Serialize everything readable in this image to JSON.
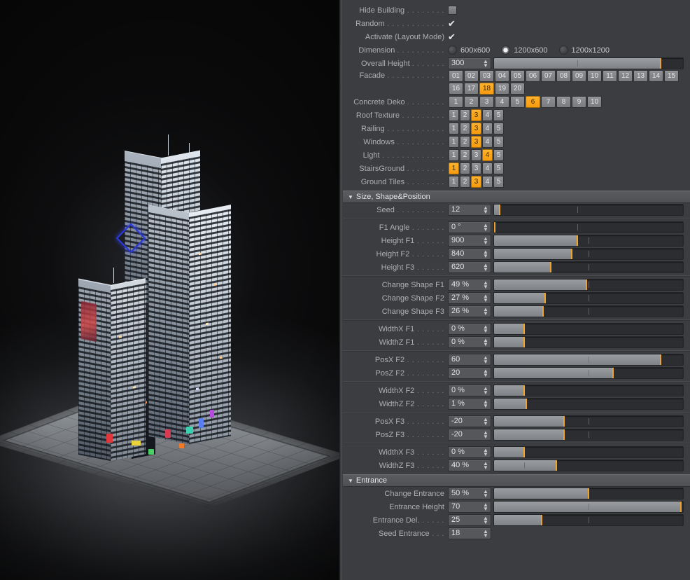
{
  "viewport": {
    "name": "3d-perspective-viewport",
    "scene_description": "Rendered night skyscraper complex on a paved plaza base"
  },
  "panel": {
    "toggles": [
      {
        "label": "Hide Building",
        "dots": ". . . . . . . .",
        "type": "checkbox",
        "checked": false
      },
      {
        "label": "Random",
        "dots": ". . . . . . . . . . . .",
        "type": "checkbox",
        "checked": true
      },
      {
        "label": "Activate (Layout Mode)",
        "dots": "",
        "type": "checkbox",
        "checked": true
      }
    ],
    "dimension": {
      "label": "Dimension",
      "dots": ". . . . . . . . . .",
      "options": [
        "600x600",
        "1200x600",
        "1200x1200"
      ],
      "selected_index": 1
    },
    "overall_height": {
      "label": "Overall Height",
      "dots": ". . . . . . .",
      "value": "300",
      "fill_pct": 88,
      "mark_pct": 88,
      "tick_pct": 44
    },
    "facade": {
      "label": "Facade",
      "dots": ". . . . . . . . . . . .",
      "options": [
        "01",
        "02",
        "03",
        "04",
        "05",
        "06",
        "07",
        "08",
        "09",
        "10",
        "11",
        "12",
        "13",
        "14",
        "15",
        "16",
        "17",
        "18",
        "19",
        "20"
      ],
      "selected": "18"
    },
    "concrete_deko": {
      "label": "Concrete Deko",
      "dots": ". . . . . . . .",
      "options": [
        "1",
        "2",
        "3",
        "4",
        "5",
        "6",
        "7",
        "8",
        "9",
        "10"
      ],
      "selected": "6"
    },
    "small_groups": [
      {
        "label": "Roof Texture",
        "dots": ". . . . . . . . .",
        "options": [
          "1",
          "2",
          "3",
          "4",
          "5"
        ],
        "selected": "3"
      },
      {
        "label": "Railing",
        "dots": ". . . . . . . . . . . .",
        "options": [
          "1",
          "2",
          "3",
          "4",
          "5"
        ],
        "selected": "3"
      },
      {
        "label": "Windows",
        "dots": ". . . . . . . . . .",
        "options": [
          "1",
          "2",
          "3",
          "4",
          "5"
        ],
        "selected": "3"
      },
      {
        "label": "Light",
        "dots": ". . . . . . . . . . . . .",
        "options": [
          "1",
          "2",
          "3",
          "4",
          "5"
        ],
        "selected": "4"
      },
      {
        "label": "StairsGround",
        "dots": ". . . . . . . .",
        "options": [
          "1",
          "2",
          "3",
          "4",
          "5"
        ],
        "selected": "1"
      },
      {
        "label": "Ground Tiles",
        "dots": ". . . . . . . .",
        "options": [
          "1",
          "2",
          "3",
          "4",
          "5"
        ],
        "selected": "3"
      }
    ],
    "section_size": {
      "title": "Size, Shape&Position",
      "groups": [
        {
          "rows": [
            {
              "label": "Seed",
              "dots": ". . . . . . . . . .",
              "value": "12",
              "fill_pct": 3,
              "mark_pct": 3,
              "tick_pct": 44
            }
          ]
        },
        {
          "rows": [
            {
              "label": "F1 Angle",
              "dots": ". . . . . . .",
              "value": "0 °",
              "fill_pct": 0,
              "mark_pct": 0.5,
              "tick_pct": 44
            },
            {
              "label": "Height F1",
              "dots": ". . . . . .",
              "value": "900",
              "fill_pct": 44,
              "mark_pct": 44,
              "tick_pct": 50
            },
            {
              "label": "Height F2",
              "dots": ". . . . . . .",
              "value": "840",
              "fill_pct": 41,
              "mark_pct": 41,
              "tick_pct": 50
            },
            {
              "label": "Height F3",
              "dots": ". . . . . .",
              "value": "620",
              "fill_pct": 30,
              "mark_pct": 30,
              "tick_pct": 50
            }
          ]
        },
        {
          "rows": [
            {
              "label": "Change Shape F1",
              "dots": "",
              "value": "49 %",
              "fill_pct": 49,
              "mark_pct": 49,
              "tick_pct": 50
            },
            {
              "label": "Change Shape F2",
              "dots": "",
              "value": "27 %",
              "fill_pct": 27,
              "mark_pct": 27,
              "tick_pct": 50
            },
            {
              "label": "Change Shape F3",
              "dots": "",
              "value": "26 %",
              "fill_pct": 26,
              "mark_pct": 26,
              "tick_pct": 50
            }
          ]
        },
        {
          "rows": [
            {
              "label": "WidthX F1",
              "dots": ". . . . . .",
              "value": "0 %",
              "fill_pct": 16,
              "mark_pct": 16,
              "tick_pct": 0
            },
            {
              "label": "WidthZ F1",
              "dots": ". . . . . .",
              "value": "0 %",
              "fill_pct": 16,
              "mark_pct": 16,
              "tick_pct": 0
            }
          ]
        },
        {
          "rows": [
            {
              "label": "PosX F2",
              "dots": ". . . . . . . .",
              "value": "60",
              "fill_pct": 88,
              "mark_pct": 88,
              "tick_pct": 50
            },
            {
              "label": "PosZ F2",
              "dots": ". . . . . . . .",
              "value": "20",
              "fill_pct": 63,
              "mark_pct": 63,
              "tick_pct": 50
            }
          ]
        },
        {
          "rows": [
            {
              "label": "WidthX F2",
              "dots": ". . . . . .",
              "value": "0 %",
              "fill_pct": 16,
              "mark_pct": 16,
              "tick_pct": 0
            },
            {
              "label": "WidthZ F2",
              "dots": ". . . . . .",
              "value": "1 %",
              "fill_pct": 17,
              "mark_pct": 17,
              "tick_pct": 0
            }
          ]
        },
        {
          "rows": [
            {
              "label": "PosX F3",
              "dots": ". . . . . . . .",
              "value": "-20",
              "fill_pct": 37,
              "mark_pct": 37,
              "tick_pct": 50
            },
            {
              "label": "PosZ F3",
              "dots": ". . . . . . . .",
              "value": "-20",
              "fill_pct": 37,
              "mark_pct": 37,
              "tick_pct": 50
            }
          ]
        },
        {
          "rows": [
            {
              "label": "WidthX F3",
              "dots": ". . . . . .",
              "value": "0 %",
              "fill_pct": 16,
              "mark_pct": 16,
              "tick_pct": 0
            },
            {
              "label": "WidthZ F3",
              "dots": ". . . . . .",
              "value": "40 %",
              "fill_pct": 33,
              "mark_pct": 33,
              "tick_pct": 16
            }
          ]
        }
      ]
    },
    "section_entrance": {
      "title": "Entrance",
      "rows": [
        {
          "label": "Change Entrance",
          "dots": "",
          "value": "50 %",
          "fill_pct": 50,
          "mark_pct": 50,
          "tick_pct": 50,
          "slider": true
        },
        {
          "label": "Entrance Height",
          "dots": "",
          "value": "70",
          "fill_pct": 99,
          "mark_pct": 99,
          "tick_pct": 50,
          "slider": true
        },
        {
          "label": "Entrance Del.",
          "dots": ". . . . .",
          "value": "25",
          "fill_pct": 25,
          "mark_pct": 25,
          "tick_pct": 50,
          "slider": true
        },
        {
          "label": "Seed Entrance",
          "dots": ". . .",
          "value": "18",
          "slider": false
        }
      ]
    }
  },
  "colors": {
    "panel_bg": "#3c3d40",
    "accent_orange": "#f0a32a",
    "button_on": "#ffb12a",
    "slider_fill": "#8b8e92",
    "slider_track": "#2c2d30",
    "text": "#bcbec2",
    "section_header": "#545659"
  }
}
